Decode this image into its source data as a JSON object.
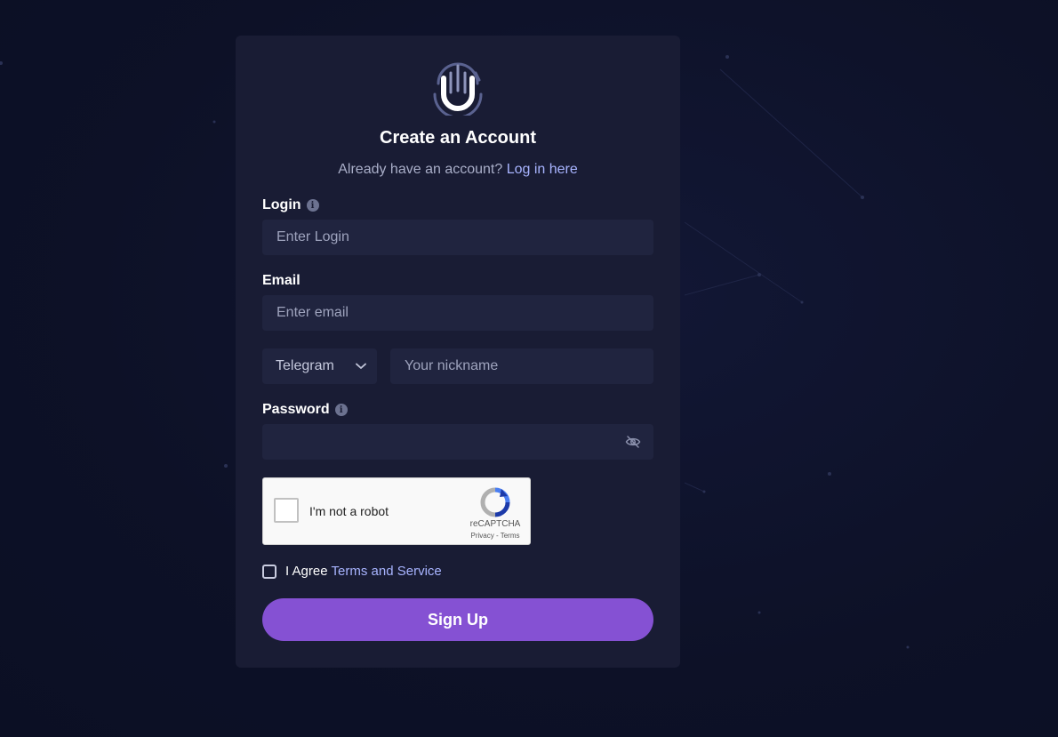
{
  "header": {
    "title": "Create an Account",
    "subtitle_text": "Already have an account?",
    "login_link": "Log in here"
  },
  "fields": {
    "login": {
      "label": "Login",
      "placeholder": "Enter Login"
    },
    "email": {
      "label": "Email",
      "placeholder": "Enter email"
    },
    "messenger": {
      "selected": "Telegram",
      "placeholder": "Your nickname"
    },
    "password": {
      "label": "Password",
      "placeholder": ""
    }
  },
  "recaptcha": {
    "label": "I'm not a robot",
    "brand": "reCAPTCHA",
    "links": "Privacy - Terms"
  },
  "agreement": {
    "text": "I Agree",
    "link": "Terms and Service"
  },
  "actions": {
    "signup_label": "Sign Up"
  },
  "icons": {
    "logo": "fingerprint-logo-icon",
    "info": "info-icon",
    "chevron": "chevron-down-icon",
    "eye": "eye-off-icon"
  },
  "colors": {
    "background": "#0e1228",
    "card": "#191c34",
    "input": "#20243f",
    "accent": "#8551d3",
    "link": "#a8b4ff"
  }
}
